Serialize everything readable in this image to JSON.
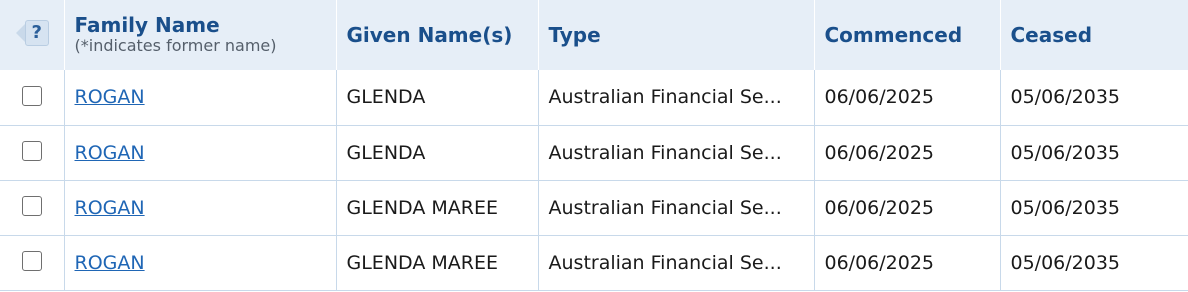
{
  "table": {
    "help_label": "?",
    "headers": {
      "family_name": "Family Name",
      "family_name_note": "(*indicates former name)",
      "given_names": "Given Name(s)",
      "type": "Type",
      "commenced": "Commenced",
      "ceased": "Ceased"
    },
    "rows": [
      {
        "family_name": "ROGAN",
        "given_names": "GLENDA",
        "type": "Australian Financial Se...",
        "commenced": "06/06/2025",
        "ceased": "05/06/2035"
      },
      {
        "family_name": "ROGAN",
        "given_names": "GLENDA",
        "type": "Australian Financial Se...",
        "commenced": "06/06/2025",
        "ceased": "05/06/2035"
      },
      {
        "family_name": "ROGAN",
        "given_names": "GLENDA MAREE",
        "type": "Australian Financial Se...",
        "commenced": "06/06/2025",
        "ceased": "05/06/2035"
      },
      {
        "family_name": "ROGAN",
        "given_names": "GLENDA MAREE",
        "type": "Australian Financial Se...",
        "commenced": "06/06/2025",
        "ceased": "05/06/2035"
      }
    ]
  },
  "colors": {
    "header_background": "#e6eef7",
    "header_text": "#1a4f8b",
    "link": "#1f66b5",
    "row_border": "#c8d9ea"
  }
}
